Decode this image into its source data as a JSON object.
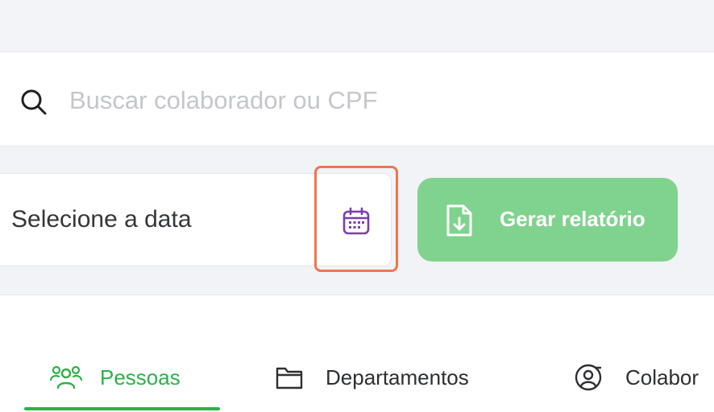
{
  "search": {
    "placeholder": "Buscar colaborador ou CPF",
    "icon": "search-icon"
  },
  "filters": {
    "date_placeholder": "Selecione a data",
    "calendar_icon": "calendar-icon",
    "calendar_icon_color": "#7b3fb0",
    "highlight_color": "#f0754e",
    "report_button": {
      "label": "Gerar relatório",
      "icon": "file-download-icon",
      "color": "#80d38e"
    }
  },
  "tabs": [
    {
      "label": "Pessoas",
      "icon": "people-icon",
      "active": true
    },
    {
      "label": "Departamentos",
      "icon": "folder-icon",
      "active": false
    },
    {
      "label": "Colabor",
      "icon": "user-circle-icon",
      "active": false
    }
  ],
  "colors": {
    "accent": "#2cb148",
    "text": "#2d2f33",
    "placeholder": "#c4c6cc"
  }
}
